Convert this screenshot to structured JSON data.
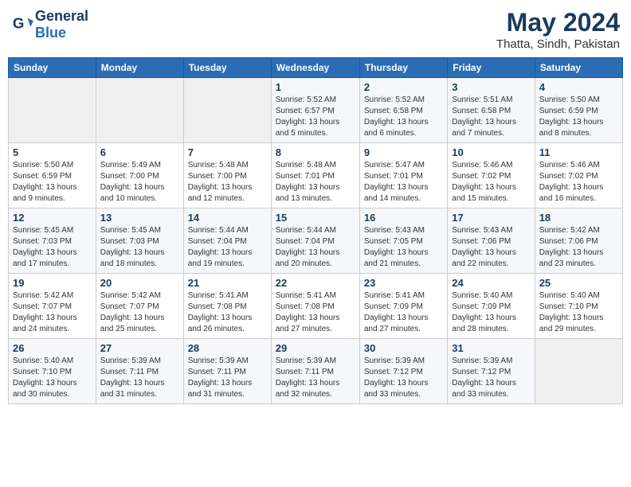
{
  "header": {
    "logo_general": "General",
    "logo_blue": "Blue",
    "month_title": "May 2024",
    "subtitle": "Thatta, Sindh, Pakistan"
  },
  "days_of_week": [
    "Sunday",
    "Monday",
    "Tuesday",
    "Wednesday",
    "Thursday",
    "Friday",
    "Saturday"
  ],
  "weeks": [
    [
      {
        "day": "",
        "info": ""
      },
      {
        "day": "",
        "info": ""
      },
      {
        "day": "",
        "info": ""
      },
      {
        "day": "1",
        "info": "Sunrise: 5:52 AM\nSunset: 6:57 PM\nDaylight: 13 hours\nand 5 minutes."
      },
      {
        "day": "2",
        "info": "Sunrise: 5:52 AM\nSunset: 6:58 PM\nDaylight: 13 hours\nand 6 minutes."
      },
      {
        "day": "3",
        "info": "Sunrise: 5:51 AM\nSunset: 6:58 PM\nDaylight: 13 hours\nand 7 minutes."
      },
      {
        "day": "4",
        "info": "Sunrise: 5:50 AM\nSunset: 6:59 PM\nDaylight: 13 hours\nand 8 minutes."
      }
    ],
    [
      {
        "day": "5",
        "info": "Sunrise: 5:50 AM\nSunset: 6:59 PM\nDaylight: 13 hours\nand 9 minutes."
      },
      {
        "day": "6",
        "info": "Sunrise: 5:49 AM\nSunset: 7:00 PM\nDaylight: 13 hours\nand 10 minutes."
      },
      {
        "day": "7",
        "info": "Sunrise: 5:48 AM\nSunset: 7:00 PM\nDaylight: 13 hours\nand 12 minutes."
      },
      {
        "day": "8",
        "info": "Sunrise: 5:48 AM\nSunset: 7:01 PM\nDaylight: 13 hours\nand 13 minutes."
      },
      {
        "day": "9",
        "info": "Sunrise: 5:47 AM\nSunset: 7:01 PM\nDaylight: 13 hours\nand 14 minutes."
      },
      {
        "day": "10",
        "info": "Sunrise: 5:46 AM\nSunset: 7:02 PM\nDaylight: 13 hours\nand 15 minutes."
      },
      {
        "day": "11",
        "info": "Sunrise: 5:46 AM\nSunset: 7:02 PM\nDaylight: 13 hours\nand 16 minutes."
      }
    ],
    [
      {
        "day": "12",
        "info": "Sunrise: 5:45 AM\nSunset: 7:03 PM\nDaylight: 13 hours\nand 17 minutes."
      },
      {
        "day": "13",
        "info": "Sunrise: 5:45 AM\nSunset: 7:03 PM\nDaylight: 13 hours\nand 18 minutes."
      },
      {
        "day": "14",
        "info": "Sunrise: 5:44 AM\nSunset: 7:04 PM\nDaylight: 13 hours\nand 19 minutes."
      },
      {
        "day": "15",
        "info": "Sunrise: 5:44 AM\nSunset: 7:04 PM\nDaylight: 13 hours\nand 20 minutes."
      },
      {
        "day": "16",
        "info": "Sunrise: 5:43 AM\nSunset: 7:05 PM\nDaylight: 13 hours\nand 21 minutes."
      },
      {
        "day": "17",
        "info": "Sunrise: 5:43 AM\nSunset: 7:06 PM\nDaylight: 13 hours\nand 22 minutes."
      },
      {
        "day": "18",
        "info": "Sunrise: 5:42 AM\nSunset: 7:06 PM\nDaylight: 13 hours\nand 23 minutes."
      }
    ],
    [
      {
        "day": "19",
        "info": "Sunrise: 5:42 AM\nSunset: 7:07 PM\nDaylight: 13 hours\nand 24 minutes."
      },
      {
        "day": "20",
        "info": "Sunrise: 5:42 AM\nSunset: 7:07 PM\nDaylight: 13 hours\nand 25 minutes."
      },
      {
        "day": "21",
        "info": "Sunrise: 5:41 AM\nSunset: 7:08 PM\nDaylight: 13 hours\nand 26 minutes."
      },
      {
        "day": "22",
        "info": "Sunrise: 5:41 AM\nSunset: 7:08 PM\nDaylight: 13 hours\nand 27 minutes."
      },
      {
        "day": "23",
        "info": "Sunrise: 5:41 AM\nSunset: 7:09 PM\nDaylight: 13 hours\nand 27 minutes."
      },
      {
        "day": "24",
        "info": "Sunrise: 5:40 AM\nSunset: 7:09 PM\nDaylight: 13 hours\nand 28 minutes."
      },
      {
        "day": "25",
        "info": "Sunrise: 5:40 AM\nSunset: 7:10 PM\nDaylight: 13 hours\nand 29 minutes."
      }
    ],
    [
      {
        "day": "26",
        "info": "Sunrise: 5:40 AM\nSunset: 7:10 PM\nDaylight: 13 hours\nand 30 minutes."
      },
      {
        "day": "27",
        "info": "Sunrise: 5:39 AM\nSunset: 7:11 PM\nDaylight: 13 hours\nand 31 minutes."
      },
      {
        "day": "28",
        "info": "Sunrise: 5:39 AM\nSunset: 7:11 PM\nDaylight: 13 hours\nand 31 minutes."
      },
      {
        "day": "29",
        "info": "Sunrise: 5:39 AM\nSunset: 7:11 PM\nDaylight: 13 hours\nand 32 minutes."
      },
      {
        "day": "30",
        "info": "Sunrise: 5:39 AM\nSunset: 7:12 PM\nDaylight: 13 hours\nand 33 minutes."
      },
      {
        "day": "31",
        "info": "Sunrise: 5:39 AM\nSunset: 7:12 PM\nDaylight: 13 hours\nand 33 minutes."
      },
      {
        "day": "",
        "info": ""
      }
    ]
  ]
}
